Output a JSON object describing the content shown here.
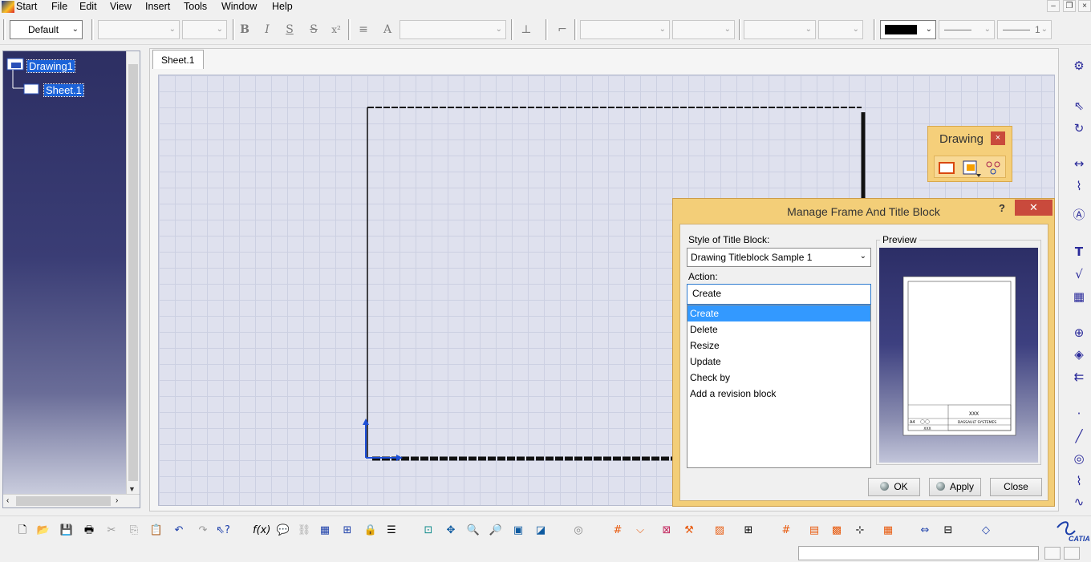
{
  "menu": {
    "items": [
      {
        "label": "Start"
      },
      {
        "label": "File"
      },
      {
        "label": "Edit"
      },
      {
        "label": "View"
      },
      {
        "label": "Insert"
      },
      {
        "label": "Tools"
      },
      {
        "label": "Window"
      },
      {
        "label": "Help"
      }
    ]
  },
  "toolbar": {
    "style_combo": "Default",
    "bold": "B",
    "italic": "I",
    "underline": "S",
    "strike": "S",
    "superscript": "x²",
    "line_weight_value": "1"
  },
  "tree": {
    "root": "Drawing1",
    "child": "Sheet.1"
  },
  "sheet_tab": "Sheet.1",
  "drawing_toolbar": {
    "title": "Drawing",
    "close": "×"
  },
  "dialog": {
    "title": "Manage Frame And Title Block",
    "help": "?",
    "close": "✕",
    "style_label": "Style of Title Block:",
    "style_value": "Drawing Titleblock Sample 1",
    "action_label": "Action:",
    "action_value": "Create",
    "actions": [
      {
        "label": "Create",
        "selected": true
      },
      {
        "label": "Delete"
      },
      {
        "label": "Resize"
      },
      {
        "label": "Update"
      },
      {
        "label": "Check by"
      },
      {
        "label": "Add a revision block"
      }
    ],
    "preview_label": "Preview",
    "preview_text": {
      "title": "XXX",
      "company": "DASSAULT SYSTEMES",
      "size": "A4",
      "drawing_number": "XXX"
    },
    "buttons": {
      "ok": "OK",
      "apply": "Apply",
      "close": "Close"
    }
  },
  "colors": {
    "tree_bg": "#2d2f63",
    "selection": "#1b62d8",
    "dialog_frame": "#f3ce78",
    "close_red": "#c94a3c",
    "list_selected": "#3399ff",
    "canvas": "#dfe1ee"
  }
}
